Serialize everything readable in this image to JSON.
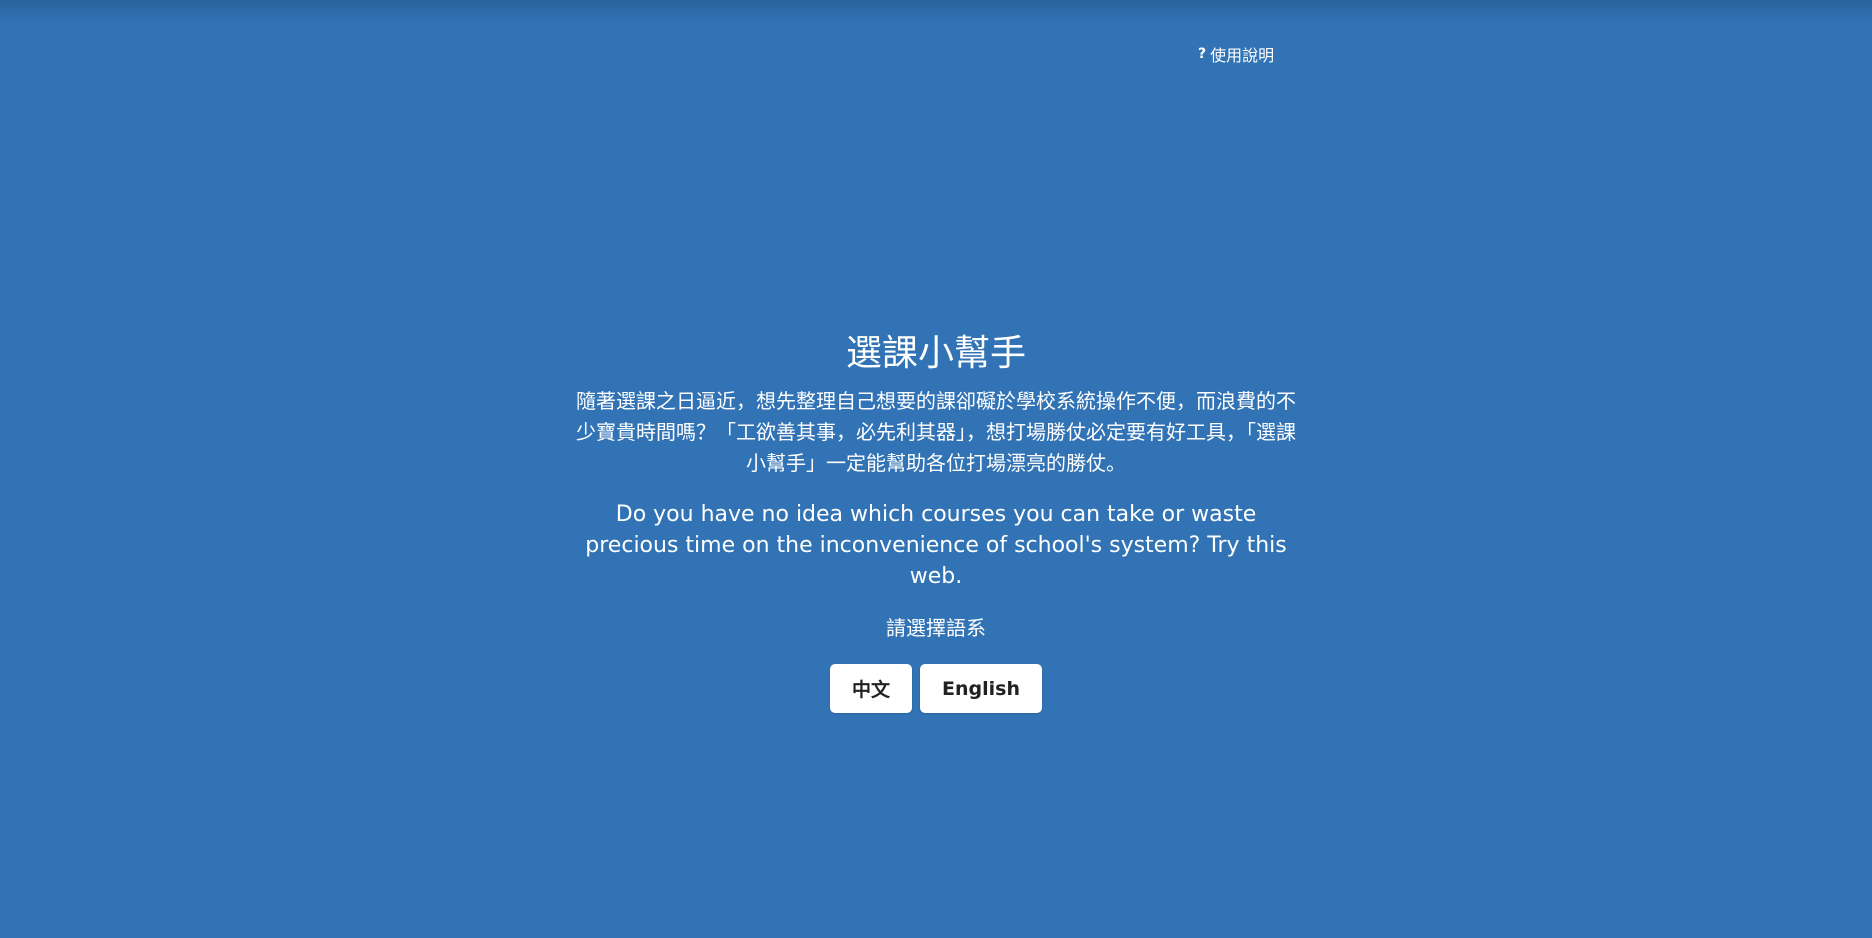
{
  "header": {
    "help_icon": "?",
    "help_label": "使用說明"
  },
  "main": {
    "title": "選課小幫手",
    "description_zh": "隨著選課之日逼近，想先整理自己想要的課卻礙於學校系統操作不便，而浪費的不少寶貴時間嗎？「工欲善其事，必先利其器」，想打場勝仗必定要有好工具，「選課小幫手」一定能幫助各位打場漂亮的勝仗。",
    "description_en": "Do you have no idea which courses you can take or waste precious time on the inconvenience of school's system? Try this web.",
    "choose_language": "請選擇語系",
    "buttons": {
      "chinese": "中文",
      "english": "English"
    }
  },
  "colors": {
    "background": "#3173b5",
    "button_bg": "#ffffff",
    "button_text": "#222222"
  }
}
